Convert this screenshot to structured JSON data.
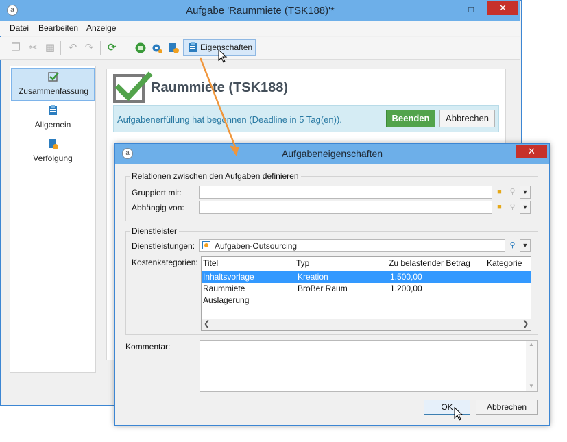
{
  "main_window": {
    "title": "Aufgabe 'Raummiete (TSK188)'*",
    "menu": [
      "Datei",
      "Bearbeiten",
      "Anzeige"
    ],
    "toolbar": {
      "properties_label": "Eigenschaften",
      "icons": [
        "copy-icon",
        "cut-icon",
        "paste-icon",
        "undo-icon",
        "redo-icon",
        "refresh-icon",
        "green-task-icon",
        "settings-icon",
        "tracking-icon",
        "clipboard-icon"
      ]
    },
    "sidebar": {
      "items": [
        {
          "label": "Zusammenfassung",
          "icon": "check-icon",
          "selected": true
        },
        {
          "label": "Allgemein",
          "icon": "clipboard-icon",
          "selected": false
        },
        {
          "label": "Verfolgung",
          "icon": "tracking-icon",
          "selected": false
        }
      ]
    },
    "content": {
      "title": "Raummiete (TSK188)",
      "status_text": "Aufgabenerfüllung hat begonnen (Deadline in 5 Tag(en)).",
      "finish_label": "Beenden",
      "abort_label": "Abbrechen"
    }
  },
  "dialog": {
    "title": "Aufgabeneigenschaften",
    "relations": {
      "legend": "Relationen zwischen den Aufgaben definieren",
      "grouped_label": "Gruppiert mit:",
      "grouped_value": "",
      "depends_label": "Abhängig von:",
      "depends_value": ""
    },
    "provider": {
      "legend": "Dienstleister",
      "services_label": "Dienstleistungen:",
      "services_value": "Aufgaben-Outsourcing",
      "cost_label": "Kostenkategorien:",
      "columns": [
        "Titel",
        "Typ",
        "Zu belastender Betrag",
        "Kategorie"
      ],
      "rows": [
        {
          "title": "Inhaltsvorlage",
          "type": "Kreation",
          "amount": "1.500,00",
          "category": "",
          "selected": true
        },
        {
          "title": "Raummiete",
          "type": "BroBer Raum",
          "amount": "1.200,00",
          "category": "",
          "selected": false
        },
        {
          "title": "Auslagerung",
          "type": "",
          "amount": "",
          "category": "",
          "selected": false
        }
      ]
    },
    "comment_label": "Kommentar:",
    "comment_value": "",
    "ok_label": "OK",
    "cancel_label": "Abbrechen"
  },
  "colors": {
    "titlebar": "#6dafe9",
    "close": "#c7312a",
    "selection": "#3399ff",
    "finish_green": "#52a34b",
    "status_bg": "#d5ecf4",
    "arrow": "#f0953a"
  }
}
